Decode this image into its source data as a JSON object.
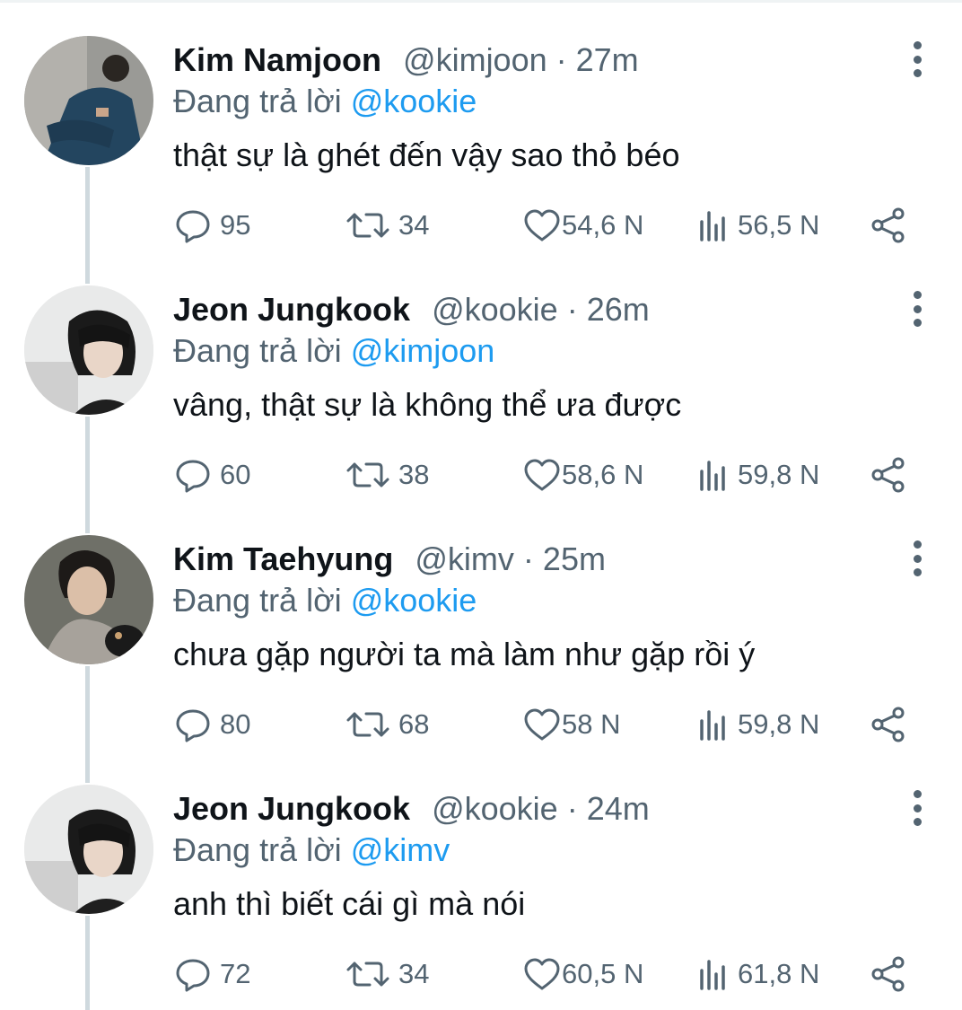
{
  "colors": {
    "text": "#0f1419",
    "muted": "#536471",
    "link": "#1d9bf0",
    "line": "#cfd9de"
  },
  "tweets": [
    {
      "name": "Kim Namjoon",
      "handle": "@kimjoon",
      "time": "27m",
      "reply_prefix": "Đang trả lời",
      "reply_to": "@kookie",
      "text": "thật sự là ghét đến vậy sao thỏ béo",
      "replies": "95",
      "retweets": "34",
      "likes": "54,6 N",
      "views": "56,5 N"
    },
    {
      "name": "Jeon Jungkook",
      "handle": "@kookie",
      "time": "26m",
      "reply_prefix": "Đang trả lời",
      "reply_to": "@kimjoon",
      "text": "vâng, thật sự là không thể ưa được",
      "replies": "60",
      "retweets": "38",
      "likes": "58,6 N",
      "views": "59,8 N"
    },
    {
      "name": "Kim Taehyung",
      "handle": "@kimv",
      "time": "25m",
      "reply_prefix": "Đang trả lời",
      "reply_to": "@kookie",
      "text": "chưa gặp người ta mà làm như gặp rồi ý",
      "replies": "80",
      "retweets": "68",
      "likes": "58 N",
      "views": "59,8 N"
    },
    {
      "name": "Jeon Jungkook",
      "handle": "@kookie",
      "time": "24m",
      "reply_prefix": "Đang trả lời",
      "reply_to": "@kimv",
      "text": "anh thì biết cái gì mà nói",
      "replies": "72",
      "retweets": "34",
      "likes": "60,5 N",
      "views": "61,8 N"
    }
  ]
}
